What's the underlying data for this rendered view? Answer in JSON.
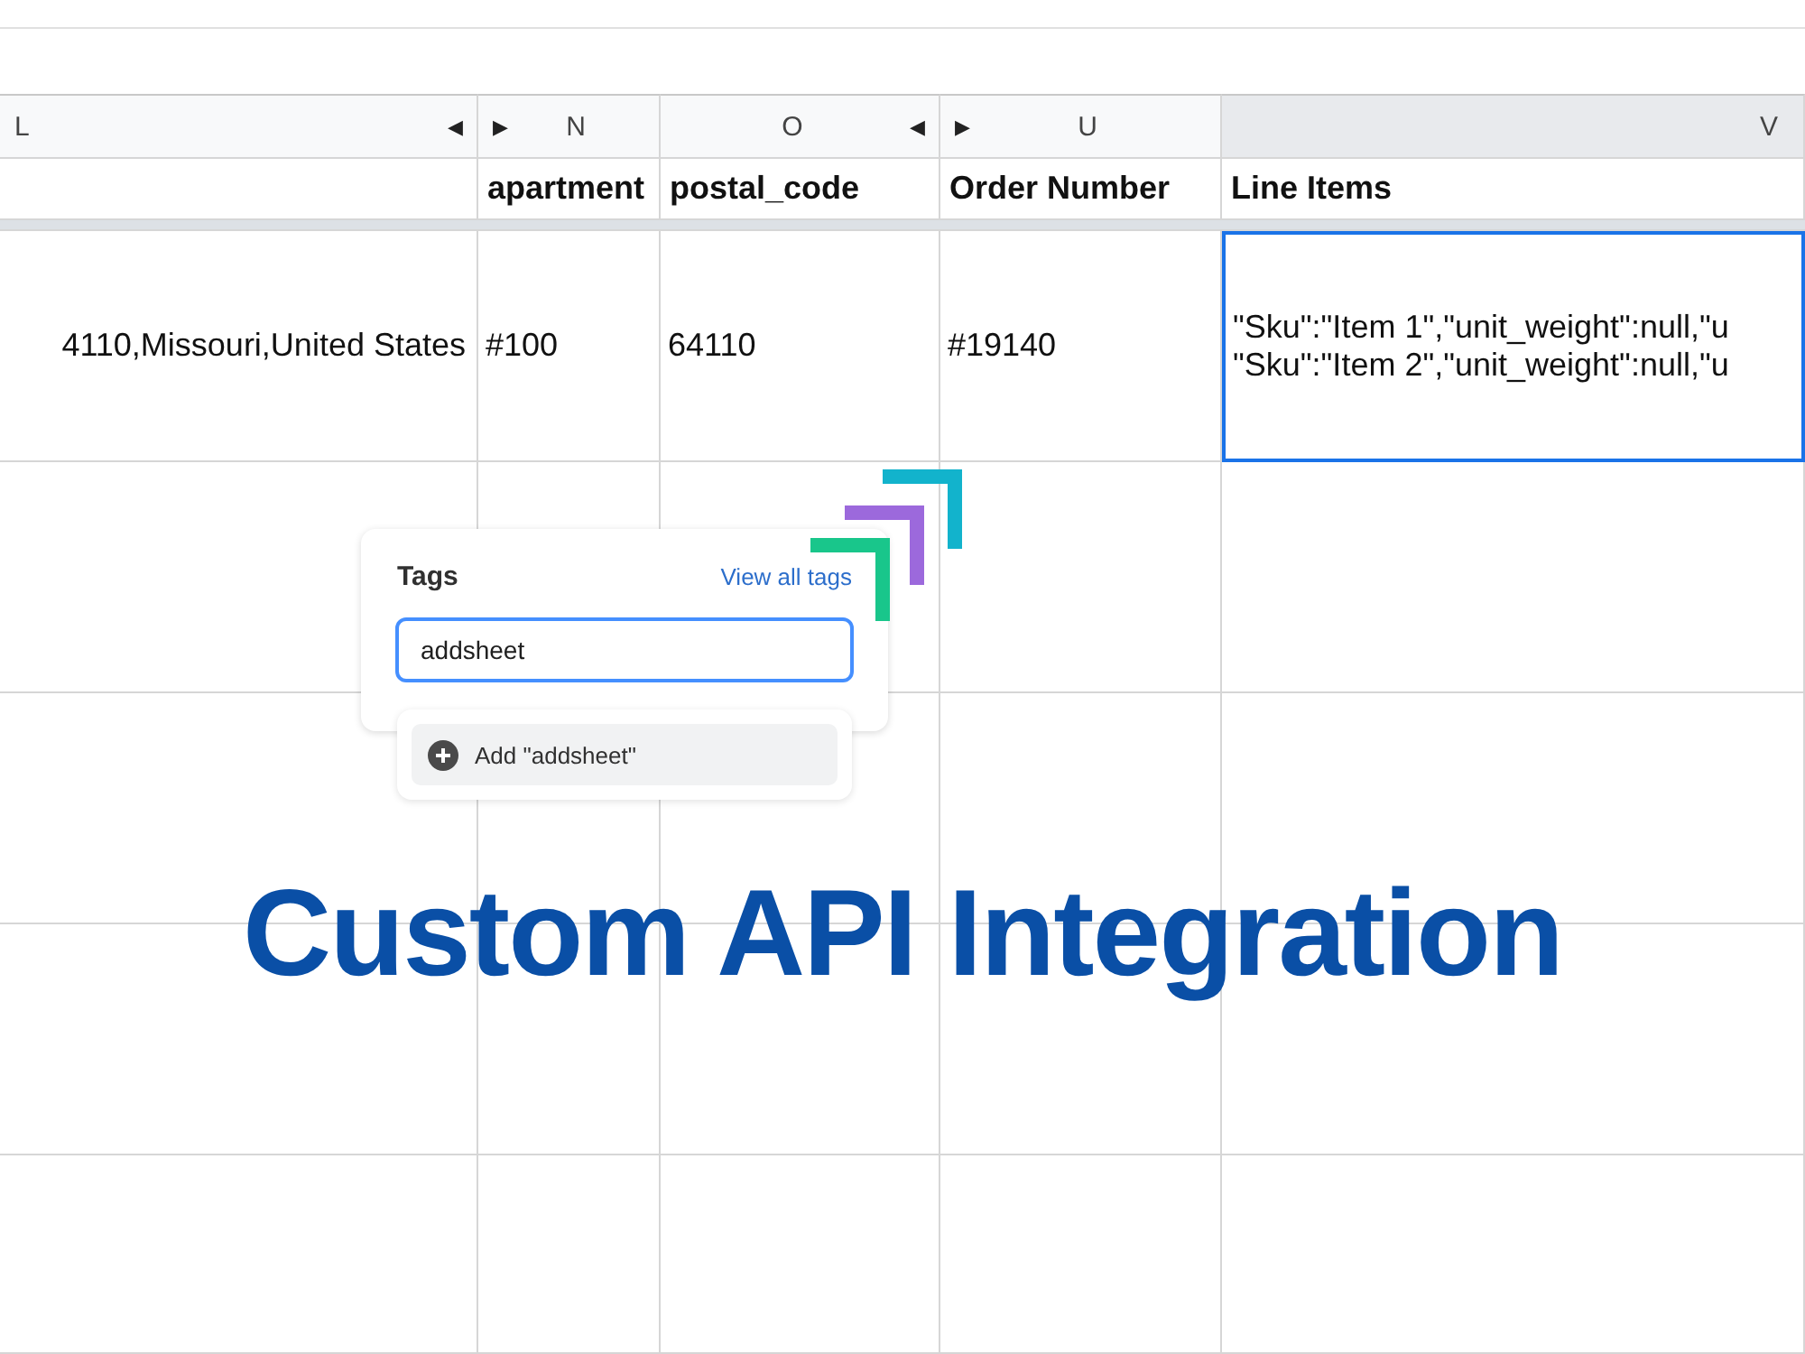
{
  "columns": [
    {
      "letter": "L",
      "after": "◀",
      "selected": false
    },
    {
      "letter": "N",
      "before": "▶",
      "selected": false
    },
    {
      "letter": "O",
      "after": "◀",
      "selected": false
    },
    {
      "letter": "U",
      "before": "▶",
      "selected": false
    },
    {
      "letter": "V",
      "selected": true
    }
  ],
  "header_row": [
    "apartment",
    "postal_code",
    "Order Number",
    "Line Items"
  ],
  "data_row": [
    {
      "lines": [
        "4110,Missouri,United States"
      ],
      "selected": false
    },
    {
      "lines": [
        "#100"
      ],
      "selected": false
    },
    {
      "lines": [
        "64110"
      ],
      "selected": false
    },
    {
      "lines": [
        "#19140"
      ],
      "selected": false
    },
    {
      "lines": [
        "\"Sku\":\"Item 1\",\"unit_weight\":null,\"u",
        "\"Sku\":\"Item 2\",\"unit_weight\":null,\"u"
      ],
      "selected": true
    }
  ],
  "tags_panel": {
    "title": "Tags",
    "link": "View all tags",
    "value": "addsheet",
    "suggestion": "Add \"addsheet\""
  },
  "headline": "Custom API Integration"
}
